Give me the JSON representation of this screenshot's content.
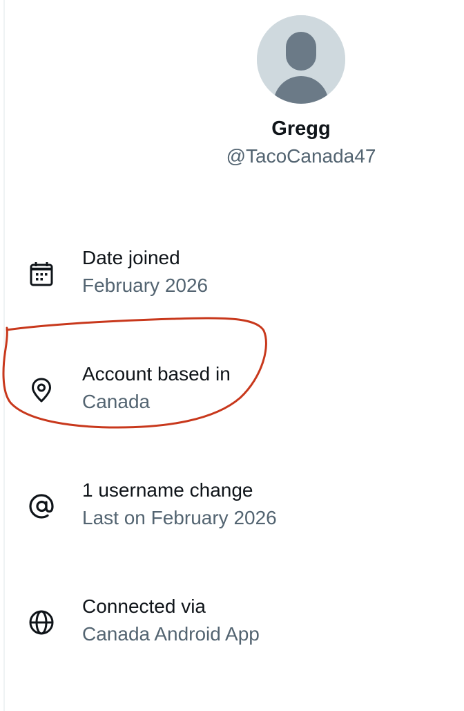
{
  "profile": {
    "display_name": "Gregg",
    "handle": "@TacoCanada47",
    "avatar_icon": "default-avatar-icon"
  },
  "info_items": [
    {
      "icon": "calendar-icon",
      "label": "Date joined",
      "value": "February 2026"
    },
    {
      "icon": "location-pin-icon",
      "label": "Account based in",
      "value": "Canada"
    },
    {
      "icon": "at-sign-icon",
      "label": "1 username change",
      "value": "Last on February 2026"
    },
    {
      "icon": "globe-icon",
      "label": "Connected via",
      "value": "Canada Android App"
    }
  ],
  "colors": {
    "primary_text": "#0f1419",
    "secondary_text": "#536471",
    "avatar_bg": "#cfd9de",
    "avatar_figure": "#6b7a87",
    "annotation_stroke": "#c8381c"
  }
}
